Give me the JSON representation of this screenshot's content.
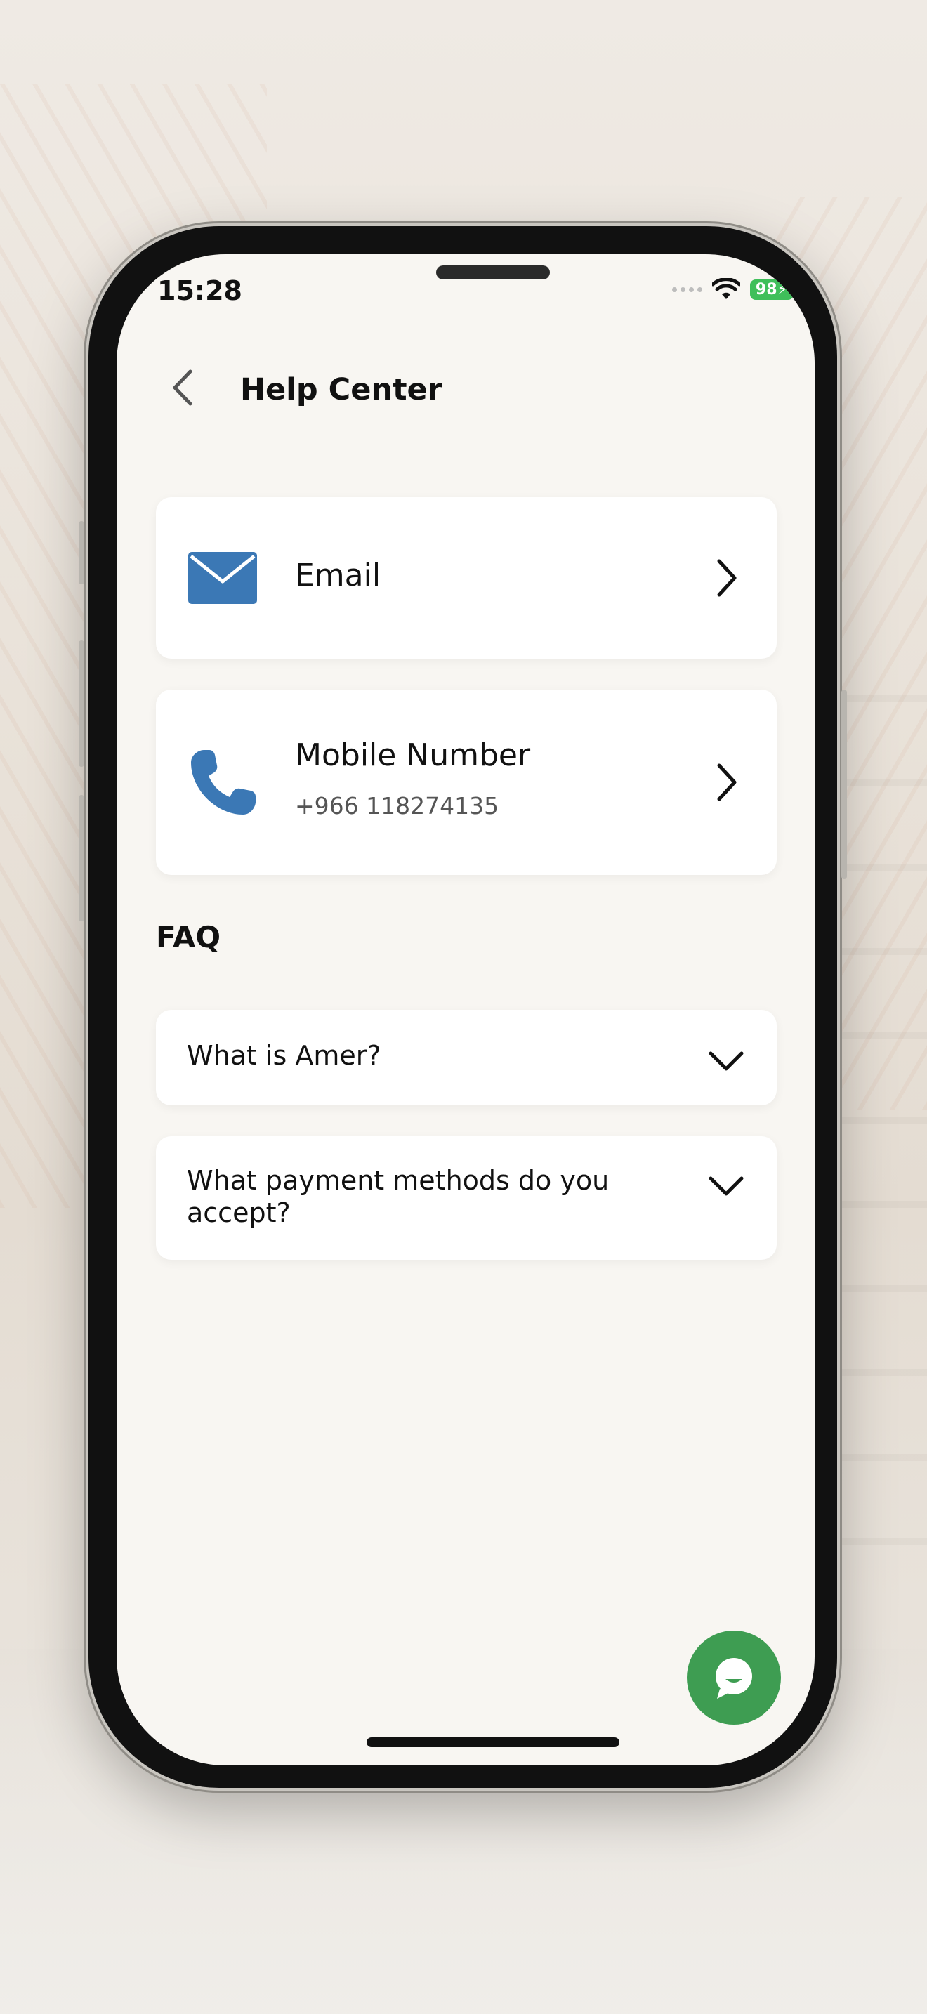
{
  "status_bar": {
    "time": "15:28",
    "battery": "98"
  },
  "header": {
    "back_icon": "chevron-left-icon",
    "title": "Help Center"
  },
  "contacts": [
    {
      "icon": "mail-icon",
      "label": "Email",
      "sub": ""
    },
    {
      "icon": "phone-icon",
      "label": "Mobile Number",
      "sub": "+966 118274135"
    }
  ],
  "faq": {
    "heading": "FAQ",
    "items": [
      {
        "question": "What is Amer?"
      },
      {
        "question": "What payment methods do you accept?"
      }
    ]
  },
  "chat": {
    "icon": "chat-bubble-icon"
  },
  "colors": {
    "accent_blue": "#3b78b5",
    "chat_green": "#3e9d52",
    "battery_green": "#3fbf5a",
    "screen_bg": "#f8f6f2"
  }
}
